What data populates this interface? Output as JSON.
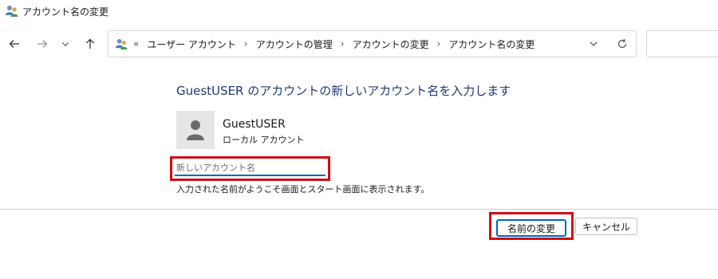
{
  "window": {
    "title": "アカウント名の変更",
    "icon": "user-accounts-icon"
  },
  "nav": {
    "back_icon": "arrow-left-icon",
    "forward_icon": "arrow-right-icon",
    "recent_icon": "chevron-down-icon",
    "up_icon": "arrow-up-icon"
  },
  "address": {
    "overflow": "«",
    "crumbs": [
      "ユーザー アカウント",
      "アカウントの管理",
      "アカウントの変更",
      "アカウント名の変更"
    ],
    "separator": "›",
    "dropdown_icon": "chevron-down-icon",
    "refresh_icon": "refresh-icon"
  },
  "main": {
    "heading": "GuestUSER のアカウントの新しいアカウント名を入力します",
    "user": {
      "name": "GuestUSER",
      "type": "ローカル アカウント",
      "avatar_icon": "user-avatar-icon"
    },
    "new_name_input": {
      "value": "",
      "placeholder": "新しいアカウント名"
    },
    "hint": "入力された名前がようこそ画面とスタート画面に表示されます。"
  },
  "actions": {
    "rename_label": "名前の変更",
    "cancel_label": "キャンセル"
  },
  "colors": {
    "heading": "#1e3a78",
    "accent": "#0067c0",
    "highlight_box": "#d10a14"
  }
}
